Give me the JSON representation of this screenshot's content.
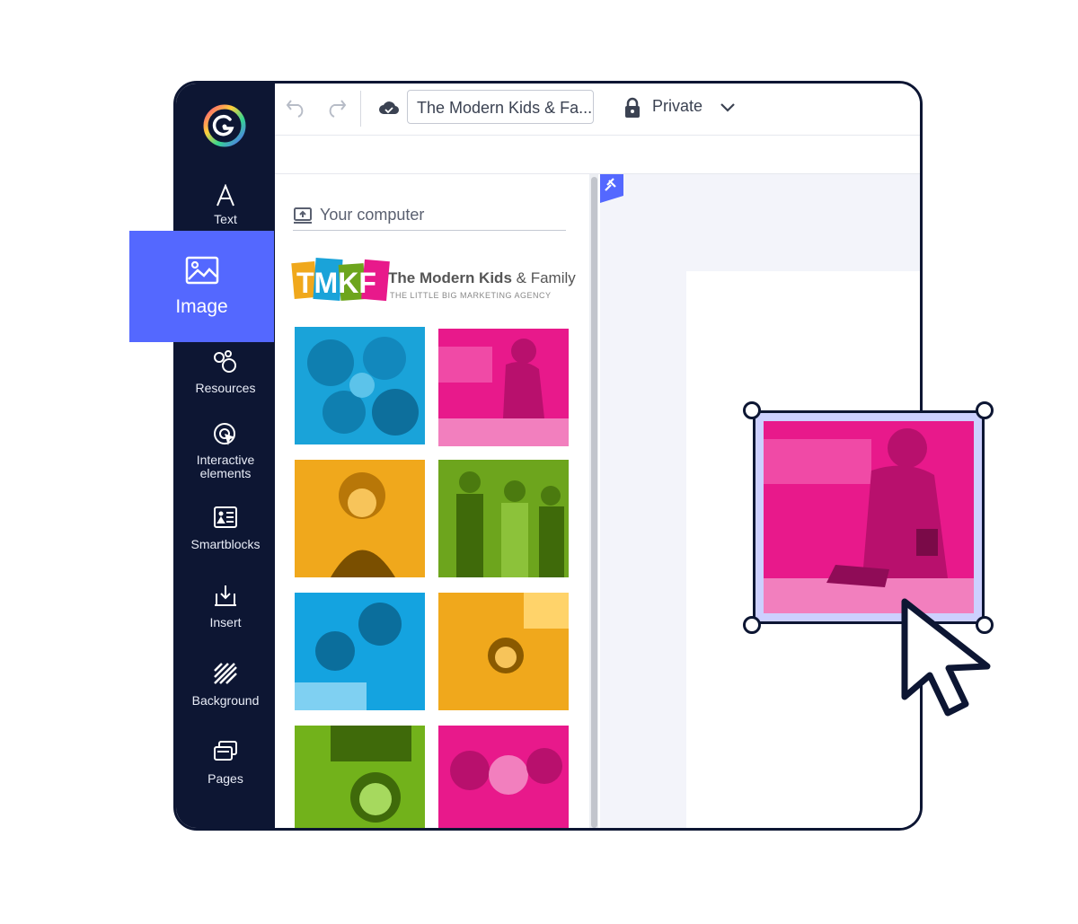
{
  "app": {
    "document_title": "The Modern Kids & Fa...",
    "visibility": "Private"
  },
  "sidebar": {
    "items": [
      {
        "label": "Text",
        "icon": "text-icon"
      },
      {
        "label": "Image",
        "icon": "image-icon",
        "active": true
      },
      {
        "label": "Resources",
        "icon": "resources-icon"
      },
      {
        "label": "Interactive elements",
        "icon": "interactive-icon"
      },
      {
        "label": "Smartblocks",
        "icon": "smartblocks-icon"
      },
      {
        "label": "Insert",
        "icon": "insert-icon"
      },
      {
        "label": "Background",
        "icon": "background-icon"
      },
      {
        "label": "Pages",
        "icon": "pages-icon"
      }
    ]
  },
  "panel": {
    "upload_label": "Your computer",
    "brand": {
      "letters": "TMKF",
      "name_strong": "The Modern Kids",
      "name_rest": " & Family",
      "tagline": "THE LITTLE BIG MARKETING AGENCY"
    },
    "thumb_colors": [
      "#1aa3d9",
      "#e8198b",
      "#f0a81c",
      "#6da51d",
      "#14a3e0",
      "#f0a81c",
      "#72b21b",
      "#e8198b"
    ]
  },
  "colors": {
    "sidebar": "#0d1633",
    "accent": "#5468ff",
    "selection": "#0d1633",
    "magenta": "#e8198b"
  }
}
